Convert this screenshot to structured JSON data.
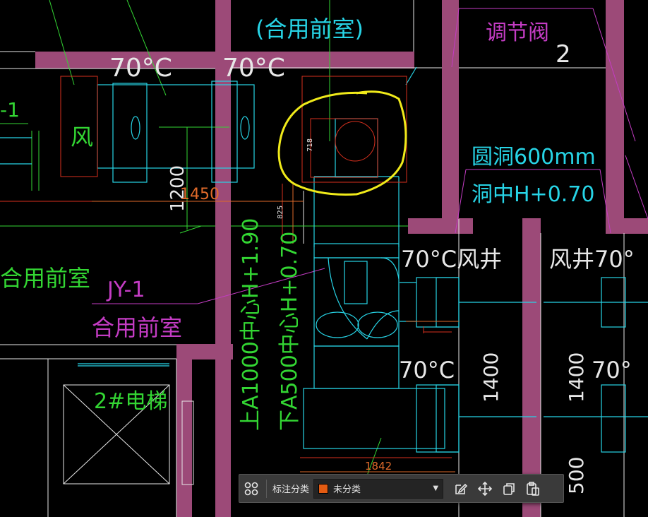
{
  "drawing": {
    "labels": {
      "shared_anteroom_top": "(合用前室)",
      "damper": "调节阀",
      "temp_70_left": "70°C",
      "temp_70_mid": "70°C",
      "wind": "风",
      "round_hole": "圆洞600mm",
      "hole_center": "洞中H+0.70",
      "num_2": "2",
      "dim_1200": "1200",
      "dim_1450": "1450",
      "dim_718": "718",
      "dim_825": "825",
      "vertical_text_1": "上A1000中心H+1.90",
      "vertical_text_2": "下A500中心H+0.70",
      "temp_70_c_shaft": "70°C风井",
      "shaft_70": "风井70°",
      "shared_anteroom_left": "合用前室",
      "jy1": "JY-1",
      "shared_anteroom_mid": "合用前室",
      "temp_70_c_low": "70°C",
      "temp_70_right_low": "70°",
      "elevator_2": "2#电梯",
      "dim_1400_a": "1400",
      "dim_1400_b": "1400",
      "dim_1842": "1842",
      "dim_1500_partial": "500",
      "edge_1": "-1"
    },
    "colors": {
      "wall_fill": "#9c4a78",
      "cyan": "#27d4e6",
      "green": "#33d633",
      "magenta": "#c43cc4",
      "red": "#d8301e",
      "orange": "#e06a2a",
      "white": "#e8e8e8",
      "highlight": "#f0ea1a"
    }
  },
  "toolbar": {
    "grid_icon": "grid-icon",
    "category_label": "标注分类",
    "category_value": "未分类",
    "category_color": "#e35b12",
    "edit_icon": "edit-icon",
    "move_icon": "move-icon",
    "copy_icon": "copy-icon",
    "paste_icon": "paste-icon"
  }
}
